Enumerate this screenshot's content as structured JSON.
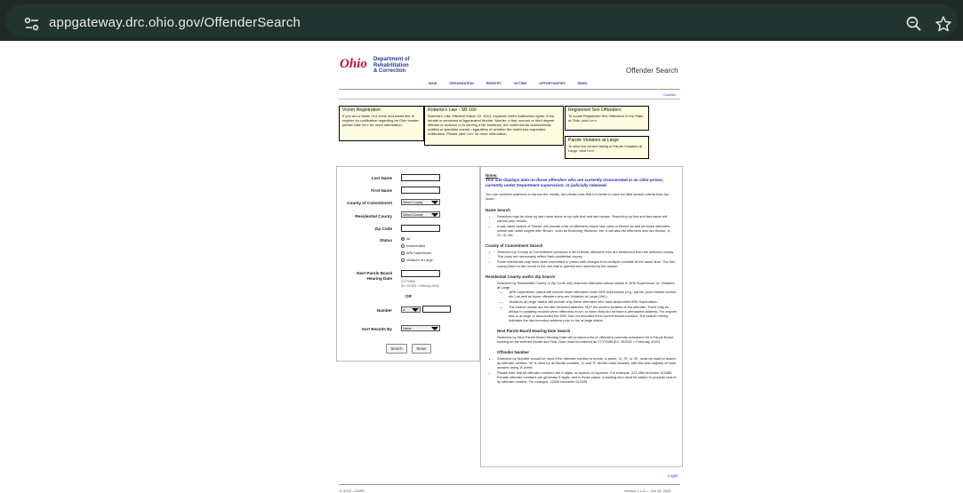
{
  "browser": {
    "url": "appgateway.drc.ohio.gov/OffenderSearch"
  },
  "header": {
    "logo_script": "Ohio",
    "logo_line1": "Department of",
    "logo_line2": "Rehabilitation",
    "logo_line3": "& Correction",
    "site_title": "Offender Search",
    "nav": [
      "MAIN",
      "ORGANIZATION",
      "REENTRY",
      "VICTIMS",
      "OPPORTUNITIES",
      "NEWS"
    ],
    "contact": "Contact"
  },
  "boxes": {
    "victim_title": "Victim Registration",
    "victim_body": "If you are a victim of a crime and would like to register for notification regarding an Ohio inmate, please click",
    "victim_link": "here",
    "victim_tail": "for more information.",
    "roberta_title": "Roberta's Law - SB 160",
    "roberta_body": "Roberta's Law, effective March 22, 2013, expands victim notification rights. If the inmate is convicted of Aggravated Murder, Murder, a first, second or third degree offense of violence or is serving a life sentence, the victim will be automatically notified of specified events, regardless of whether the victim has requested notification. Please click",
    "roberta_link": "here",
    "roberta_tail": "for more information.",
    "sex_title": "Registered Sex Offenders",
    "sex_body": "To locate Registered Sex Offenders in the State of Ohio, click",
    "sex_link": "here.",
    "parole_title": "Parole Violators at Large",
    "parole_body": "To view the current listing of Parole Violators at Large, click",
    "parole_link": "here."
  },
  "form": {
    "last_name_label": "Last Name",
    "first_name_label": "First Name",
    "county_commitment_label": "County of Commitment",
    "county_commitment_value": "Select County",
    "residential_county_label": "Residential County",
    "residential_county_value": "Select County",
    "zip_label": "Zip Code",
    "status_label": "Status",
    "status_options": [
      "All",
      "Incarcerated",
      "APA Supervision",
      "Violators at Large"
    ],
    "parole_label_1": "Next Parole Board",
    "parole_label_2": "Hearing Date",
    "parole_hint_1": "(YYYYMM)",
    "parole_hint_2": "(Ex: 202002 = February 2020)",
    "or_label": "OR",
    "number_label": "Number",
    "number_prefix": "A",
    "sort_label": "Sort Results By",
    "sort_value": "Name",
    "search_button": "Search",
    "reset_button": "Reset"
  },
  "notes": {
    "title": "Notes:",
    "lead": "This site displays data on those offenders who are currently incarcerated in an Ohio prison, currently under Department supervision, or judicially released.",
    "combine": "You can combine searches to narrow the results, but please note that it is better to have too little search criteria than too much.",
    "name_heading": "Name Search",
    "name_items": [
      "Searches may be done by last name alone or by both first and last names. Searching by first and last name will narrow your results.",
      "A last name search of 'Brown' will provide a list of offenders whose last name is Brown as well as those offenders whose last name begins with 'Brown', such as Browning, Browner, etc. It will also list offenders who are Brown, Jr., Sr., III, etc."
    ],
    "county_heading": "County of Commitment Search",
    "county_items": [
      "Searches by County of Commitment produces a list of those offenders who are sentenced from the selected county. This does not necessarily reflect their residential county.",
      "Some individuals may have been committed to prison with charges from multiple counties at the same time. The first county listed in the record is the one that is queried and reported by the search."
    ],
    "res_heading": "Residential County and/or Zip Search",
    "res_intro": "Searches by Residential County or Zip Code only searches offenders whose status is 'APA Supervision' or 'Violators at Large.'",
    "res_items": [
      "'APA Supervision' status will include those offenders under APA Supervision (e.g., parole, post release control, etc.) as well as those offenders who are Violators at Large (VAL).",
      "'Violators at Large' status will include only those offenders who have absconded APA Supervision.",
      "The search results are the last recorded address, NOT the current location of the offender. There may be delays in updating records when offenders move, or when they do not have a permanent address. For anyone who is at-large or absconded the DRC has not recorded their current known location. The search merely indicates the last recorded address prior to the at-large status."
    ],
    "parole_heading": "Next Parole Board Hearing Date Search",
    "parole_text": "Searches by Next Parole Board Hearing Date will produce a list of offenders currently scheduled for a Parole Board hearing on the entered Month and Year. Date must be entered as YYYYMM (Ex: 202002 = February 2020).",
    "number_heading": "Offender Number",
    "number_items": [
      "Searches by Number should be used if the offender number is known. A prefix, 'A', 'R', or 'W', must be used to search by offender number. 'W' is used for all female inmates. 'A' and 'R' denote male inmates, with the vast majority of male inmates using 'A' prefix.",
      "Please note that all offender numbers are 6 digits, no spaces or hyphens. For example, 123-456 becomes 123456. Female offender numbers are generally 5 digits, and in those cases, a leading zero must be added to properly search by offender number. For example, 12345 becomes 012345."
    ]
  },
  "footer": {
    "login": "Login",
    "copyright": "© 2025 - ODRC",
    "version": "Version 2.1.4 — Oct 15, 2025"
  }
}
